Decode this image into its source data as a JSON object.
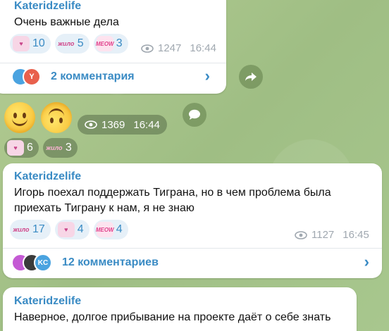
{
  "messages": [
    {
      "author": "Kateridzelife",
      "text": "Очень важные дела",
      "reactions": [
        {
          "icon": "axolotl-sticker",
          "count": "10"
        },
        {
          "icon": "zhilo-sticker",
          "label": "жило",
          "count": "5"
        },
        {
          "icon": "meow-sticker",
          "label": "MEOW",
          "count": "3"
        }
      ],
      "views": "1247",
      "time": "16:44",
      "comments": {
        "label": "2 комментария",
        "avatar_letter": "Y"
      }
    },
    {
      "emoji_reactions": [
        {
          "icon": "smiling-face-emoji"
        },
        {
          "icon": "upside-down-face-emoji"
        }
      ],
      "views": "1369",
      "time": "16:44",
      "reactions": [
        {
          "icon": "axolotl-sticker",
          "count": "6"
        },
        {
          "icon": "zhilo-sticker",
          "label": "жило",
          "count": "3"
        }
      ]
    },
    {
      "author": "Kateridzelife",
      "text": "Игорь поехал поддержать Тиграна, но в чем проблема была приехать Тиграну к нам, я не знаю",
      "reactions": [
        {
          "icon": "zhilo-sticker",
          "label": "жило",
          "count": "17"
        },
        {
          "icon": "axolotl-sticker",
          "count": "4"
        },
        {
          "icon": "meow-sticker",
          "label": "MEOW",
          "count": "4"
        }
      ],
      "views": "1127",
      "time": "16:45",
      "comments": {
        "label": "12 комментариев",
        "avatar_letters": "KC"
      }
    },
    {
      "author": "Kateridzelife",
      "text": "Наверное, долгое прибывание на проекте даёт о себе знать"
    }
  ],
  "colors": {
    "accent": "#3a8bc4",
    "bubble": "#ffffff",
    "meta": "#a0a8b0"
  }
}
